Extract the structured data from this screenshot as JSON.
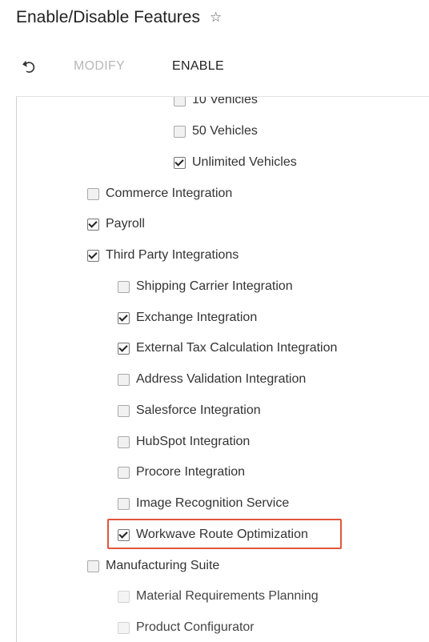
{
  "header": {
    "title": "Enable/Disable Features",
    "favorite_icon": "star-outline-icon"
  },
  "toolbar": {
    "undo_icon": "undo-icon",
    "modify_label": "MODIFY",
    "enable_label": "ENABLE"
  },
  "features": [
    {
      "label": "10 Vehicles",
      "checked": false
    },
    {
      "label": "50 Vehicles",
      "checked": false
    },
    {
      "label": "Unlimited Vehicles",
      "checked": true
    },
    {
      "label": "Commerce Integration",
      "checked": false
    },
    {
      "label": "Payroll",
      "checked": true
    },
    {
      "label": "Third Party Integrations",
      "checked": true
    },
    {
      "label": "Shipping Carrier Integration",
      "checked": false
    },
    {
      "label": "Exchange Integration",
      "checked": true
    },
    {
      "label": "External Tax Calculation Integration",
      "checked": true
    },
    {
      "label": "Address Validation Integration",
      "checked": false
    },
    {
      "label": "Salesforce Integration",
      "checked": false
    },
    {
      "label": "HubSpot Integration",
      "checked": false
    },
    {
      "label": "Procore Integration",
      "checked": false
    },
    {
      "label": "Image Recognition Service",
      "checked": false
    },
    {
      "label": "Workwave Route Optimization",
      "checked": true,
      "highlighted": true
    },
    {
      "label": "Manufacturing Suite",
      "checked": false
    },
    {
      "label": "Material Requirements Planning",
      "checked": false,
      "disabled": true
    },
    {
      "label": "Product Configurator",
      "checked": false,
      "disabled": true
    }
  ],
  "colors": {
    "highlight_border": "#e2553d",
    "disabled_text": "#b8b8b8"
  }
}
